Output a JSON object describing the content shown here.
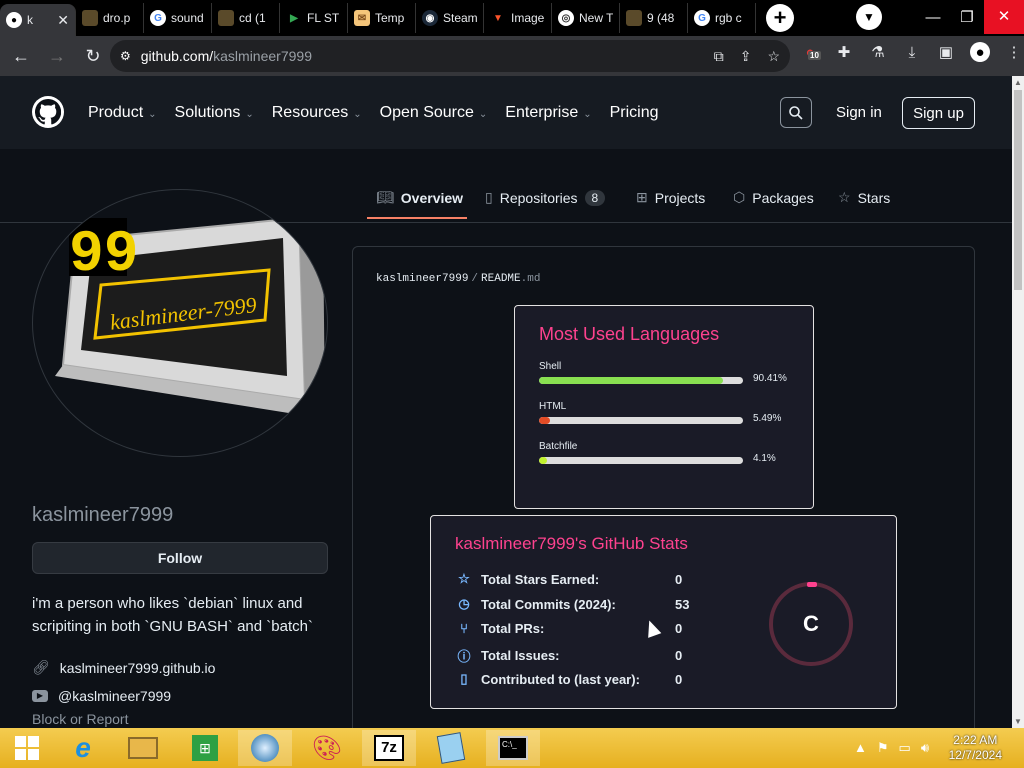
{
  "browser": {
    "tabs": [
      {
        "title": "k",
        "fav": "github-icon",
        "active": true
      },
      {
        "title": "dro.p",
        "fav": "folder-icon"
      },
      {
        "title": "sound",
        "fav": "google-icon"
      },
      {
        "title": "cd (1",
        "fav": "folder-icon"
      },
      {
        "title": "FL ST",
        "fav": "play-icon"
      },
      {
        "title": "Temp",
        "fav": "mail-icon"
      },
      {
        "title": "Steam",
        "fav": "steam-icon"
      },
      {
        "title": "Image",
        "fav": "brave-icon"
      },
      {
        "title": "New T",
        "fav": "chrome-icon"
      },
      {
        "title": "9 (48",
        "fav": "folder-icon"
      },
      {
        "title": "rgb c",
        "fav": "google-icon"
      }
    ],
    "url_host": "github.com/",
    "url_path": "kaslmineer7999",
    "extension_badge": "10"
  },
  "header": {
    "nav": [
      "Product",
      "Solutions",
      "Resources",
      "Open Source",
      "Enterprise",
      "Pricing"
    ],
    "sign_in": "Sign in",
    "sign_up": "Sign up"
  },
  "profile_tabs": {
    "overview": "Overview",
    "repositories": "Repositories",
    "repo_count": "8",
    "projects": "Projects",
    "packages": "Packages",
    "stars": "Stars"
  },
  "profile": {
    "avatar_number": "99",
    "avatar_label": "kaslmineer-7999",
    "username": "kaslmineer7999",
    "follow": "Follow",
    "bio_line1": "i'm a person who likes `debian` linux and",
    "bio_line2": "scripiting in both `GNU BASH` and `batch`",
    "website": "kaslmineer7999.github.io",
    "youtube": "@kaslmineer7999",
    "block": "Block or Report"
  },
  "readme": {
    "owner": "kaslmineer7999",
    "file": "README",
    "ext": ".md"
  },
  "languages_card": {
    "title": "Most Used Languages",
    "items": [
      {
        "name": "Shell",
        "percent": "90.41%",
        "value": 90.41,
        "color": "#89e051"
      },
      {
        "name": "HTML",
        "percent": "5.49%",
        "value": 5.49,
        "color": "#e34c26"
      },
      {
        "name": "Batchfile",
        "percent": "4.1%",
        "value": 4.1,
        "color": "#c1f12e"
      }
    ]
  },
  "stats_card": {
    "title": "kaslmineer7999's GitHub Stats",
    "rows": [
      {
        "label": "Total Stars Earned:",
        "value": "0",
        "icon": "star-icon"
      },
      {
        "label": "Total Commits (2024):",
        "value": "53",
        "icon": "history-icon"
      },
      {
        "label": "Total PRs:",
        "value": "0",
        "icon": "pull-request-icon"
      },
      {
        "label": "Total Issues:",
        "value": "0",
        "icon": "issue-icon"
      },
      {
        "label": "Contributed to (last year):",
        "value": "0",
        "icon": "repo-icon"
      }
    ],
    "rank": "C",
    "rank_color": "#fe428e"
  },
  "taskbar": {
    "time": "2:22 AM",
    "date": "12/7/2024",
    "apps": [
      "start-icon",
      "internet-explorer-icon",
      "file-explorer-icon",
      "store-icon",
      "media-icon",
      "paint-icon",
      "7zip-icon",
      "notepad-icon",
      "terminal-icon"
    ],
    "zip_label": "7z"
  }
}
